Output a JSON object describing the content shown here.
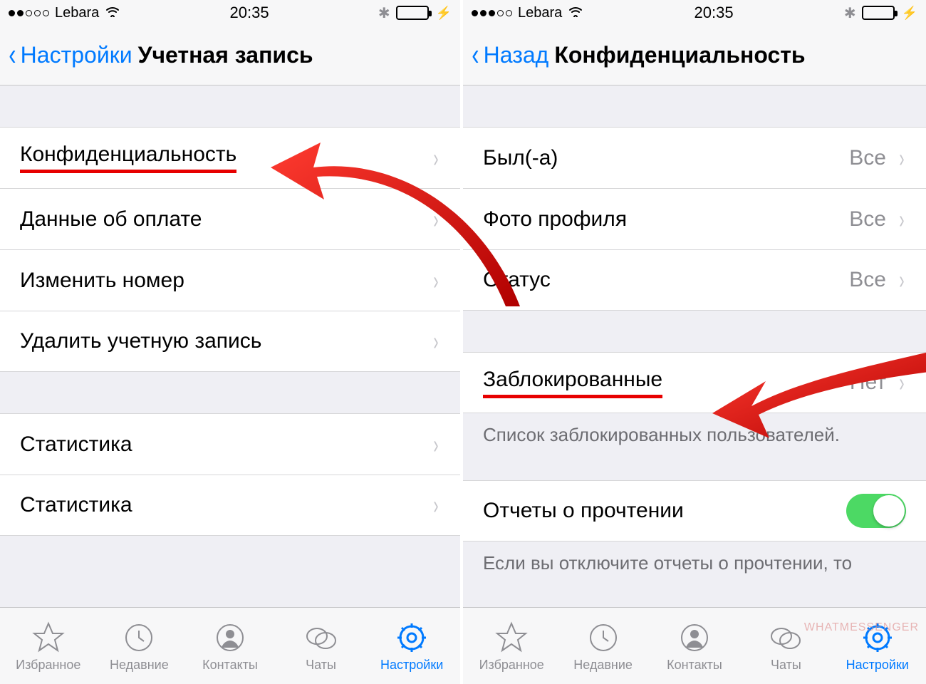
{
  "status": {
    "carrier": "Lebara",
    "time": "20:35"
  },
  "left": {
    "nav": {
      "back": "Настройки",
      "title": "Учетная запись"
    },
    "rows": [
      {
        "label": "Конфиденциальность",
        "highlighted": true
      },
      {
        "label": "Данные об оплате"
      },
      {
        "label": "Изменить номер"
      },
      {
        "label": "Удалить учетную запись"
      }
    ],
    "rows2": [
      {
        "label": "Статистика"
      },
      {
        "label": "Статистика"
      }
    ]
  },
  "right": {
    "nav": {
      "back": "Назад",
      "title": "Конфиденциальность"
    },
    "rows": [
      {
        "label": "Был(-а)",
        "value": "Все"
      },
      {
        "label": "Фото профиля",
        "value": "Все"
      },
      {
        "label": "Статус",
        "value": "Все"
      }
    ],
    "blocked": {
      "label": "Заблокированные",
      "value": "Нет",
      "highlighted": true
    },
    "blocked_footer": "Список заблокированных пользователей.",
    "read_receipts": {
      "label": "Отчеты о прочтении",
      "on": true
    },
    "read_receipts_footer": "Если вы отключите отчеты о прочтении, то"
  },
  "tabs": [
    {
      "id": "favorites",
      "label": "Избранное"
    },
    {
      "id": "recents",
      "label": "Недавние"
    },
    {
      "id": "contacts",
      "label": "Контакты"
    },
    {
      "id": "chats",
      "label": "Чаты"
    },
    {
      "id": "settings",
      "label": "Настройки",
      "active": true
    }
  ],
  "watermark": "WHATMESSENGER"
}
